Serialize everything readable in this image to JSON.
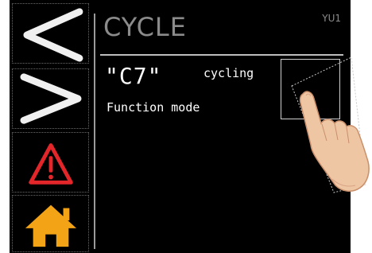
{
  "screen": {
    "title": "CYCLE",
    "unit_code": "YU1",
    "mode_code": "\"C7\"",
    "status": "cycling",
    "mode_description": "Function mode"
  },
  "sidebar": {
    "items": [
      {
        "name": "previous",
        "icon": "chevron-left-icon"
      },
      {
        "name": "next",
        "icon": "chevron-right-icon"
      },
      {
        "name": "alarm",
        "icon": "warning-triangle-icon"
      },
      {
        "name": "home",
        "icon": "home-icon"
      }
    ]
  },
  "colors": {
    "background": "#000000",
    "title_text": "#8b8b8b",
    "body_text": "#ffffff",
    "warning": "#e2262a",
    "home": "#f3a316"
  }
}
